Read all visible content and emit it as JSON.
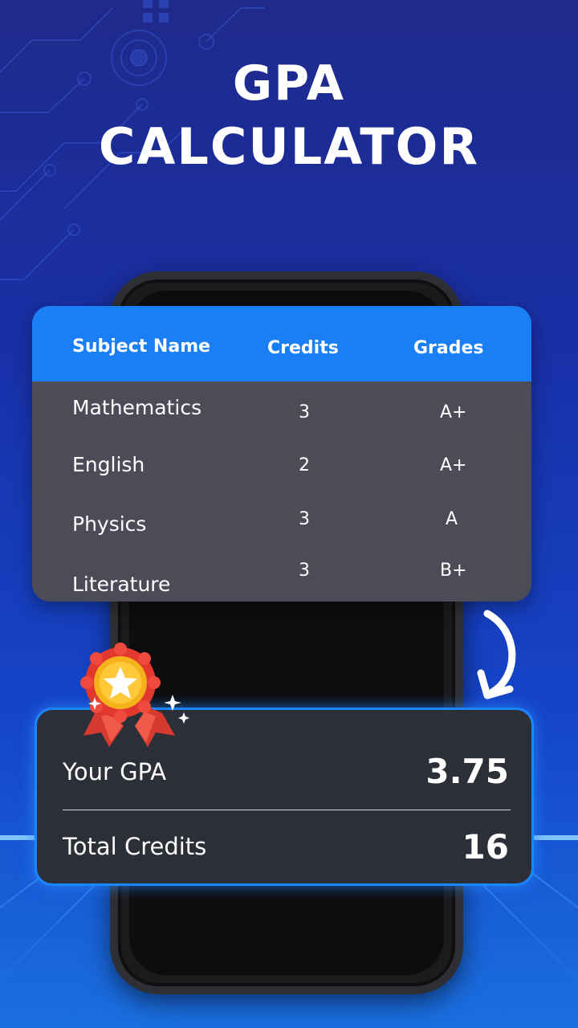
{
  "title": {
    "line1": "GPA",
    "line2": "CALCULATOR"
  },
  "table": {
    "headers": {
      "subject": "Subject Name",
      "credits": "Credits",
      "grades": "Grades"
    },
    "rows": [
      {
        "subject": "Mathematics",
        "credits": "3",
        "grade": "A+"
      },
      {
        "subject": "English",
        "credits": "2",
        "grade": "A+"
      },
      {
        "subject": "Physics",
        "credits": "3",
        "grade": "A"
      },
      {
        "subject": "Literature",
        "credits": "3",
        "grade": "B+"
      }
    ]
  },
  "result": {
    "gpa_label": "Your GPA",
    "gpa_value": "3.75",
    "credits_label": "Total Credits",
    "credits_value": "16"
  },
  "colors": {
    "header_blue": "#1a7ef5",
    "table_body": "#4b4c58",
    "result_bg": "#2d2f38",
    "glow": "#1a86ff"
  },
  "icons": [
    "award-ribbon-icon",
    "curved-arrow-down-icon",
    "sparkle-icon"
  ]
}
